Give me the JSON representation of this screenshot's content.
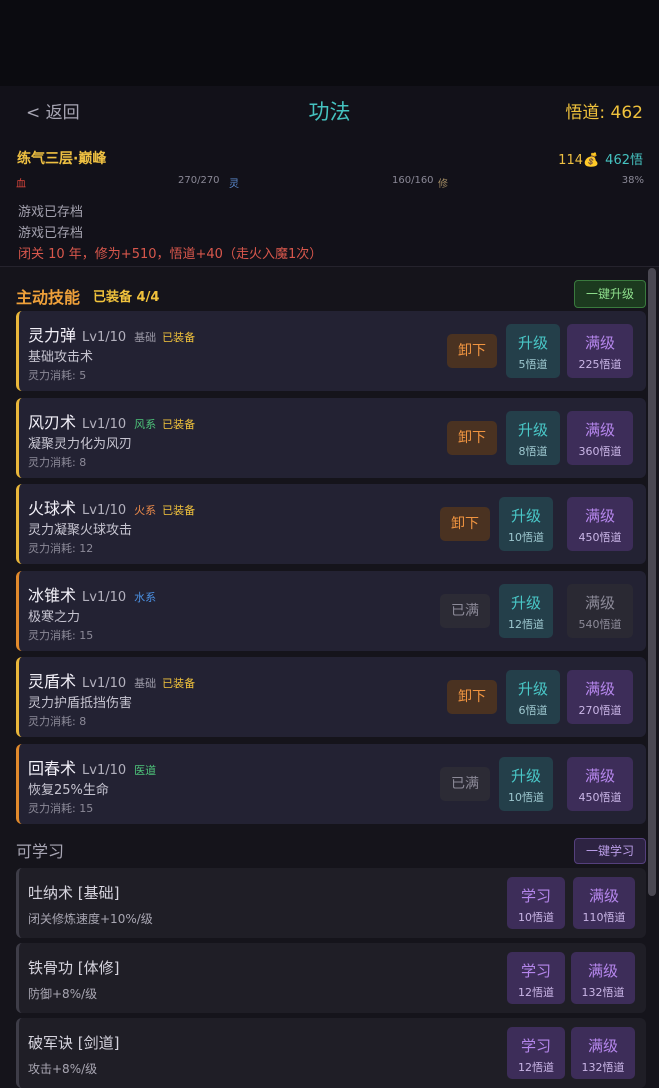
{
  "header": {
    "back_label": "< 返回",
    "title": "功法",
    "wudao_label": "悟道: 462"
  },
  "status": {
    "realm": "练气三层·巅峰",
    "coins": "114💰",
    "wudao": "462悟",
    "hp_label": "血",
    "hp_value": "270/270",
    "mp_label": "灵",
    "mp_value": "160/160",
    "cult_label": "修",
    "percent": "38%",
    "log": [
      "游戏已存档",
      "游戏已存档",
      "闭关 10 年，修为+510，悟道+40（走火入魔1次）"
    ]
  },
  "active": {
    "title": "主动技能",
    "equipped": "已装备 4/4",
    "upgrade_all": "一键升级",
    "skills": [
      {
        "name": "灵力弹",
        "level": "Lv1/10",
        "tag": "基础",
        "tag_color": "gray",
        "equipped": "已装备",
        "desc": "基础攻击术",
        "cost": "灵力消耗: 5",
        "left_btn": "卸下",
        "up_label": "升级",
        "up_cost": "5悟道",
        "max_label": "满级",
        "max_cost": "225悟道"
      },
      {
        "name": "风刃术",
        "level": "Lv1/10",
        "tag": "风系",
        "tag_color": "green",
        "equipped": "已装备",
        "desc": "凝聚灵力化为风刃",
        "cost": "灵力消耗: 8",
        "left_btn": "卸下",
        "up_label": "升级",
        "up_cost": "8悟道",
        "max_label": "满级",
        "max_cost": "360悟道"
      },
      {
        "name": "火球术",
        "level": "Lv1/10",
        "tag": "火系",
        "tag_color": "orange",
        "equipped": "已装备",
        "desc": "灵力凝聚火球攻击",
        "cost": "灵力消耗: 12",
        "left_btn": "卸下",
        "up_label": "升级",
        "up_cost": "10悟道",
        "max_label": "满级",
        "max_cost": "450悟道"
      },
      {
        "name": "冰锥术",
        "level": "Lv1/10",
        "tag": "水系",
        "tag_color": "blue",
        "equipped": "",
        "desc": "极寒之力",
        "cost": "灵力消耗: 15",
        "left_btn": "已满",
        "up_label": "升级",
        "up_cost": "12悟道",
        "max_label": "满级",
        "max_cost": "540悟道"
      },
      {
        "name": "灵盾术",
        "level": "Lv1/10",
        "tag": "基础",
        "tag_color": "gray",
        "equipped": "已装备",
        "desc": "灵力护盾抵挡伤害",
        "cost": "灵力消耗: 8",
        "left_btn": "卸下",
        "up_label": "升级",
        "up_cost": "6悟道",
        "max_label": "满级",
        "max_cost": "270悟道"
      },
      {
        "name": "回春术",
        "level": "Lv1/10",
        "tag": "医道",
        "tag_color": "green",
        "equipped": "",
        "desc": "恢复25%生命",
        "cost": "灵力消耗: 15",
        "left_btn": "已满",
        "up_label": "升级",
        "up_cost": "10悟道",
        "max_label": "满级",
        "max_cost": "450悟道"
      }
    ]
  },
  "learnable": {
    "title": "可学习",
    "learn_all": "一键学习",
    "items": [
      {
        "name": "吐纳术 [基础]",
        "desc": "闭关修炼速度+10%/级",
        "learn_label": "学习",
        "learn_cost": "10悟道",
        "max_label": "满级",
        "max_cost": "110悟道"
      },
      {
        "name": "铁骨功 [体修]",
        "desc": "防御+8%/级",
        "learn_label": "学习",
        "learn_cost": "12悟道",
        "max_label": "满级",
        "max_cost": "132悟道"
      },
      {
        "name": "破军诀 [剑道]",
        "desc": "攻击+8%/级",
        "learn_label": "学习",
        "learn_cost": "12悟道",
        "max_label": "满级",
        "max_cost": "132悟道"
      }
    ]
  },
  "colors": {
    "accent": "#45c2c0",
    "gold": "#f0c23c",
    "orange": "#eea03a",
    "purple": "#b586ec"
  }
}
